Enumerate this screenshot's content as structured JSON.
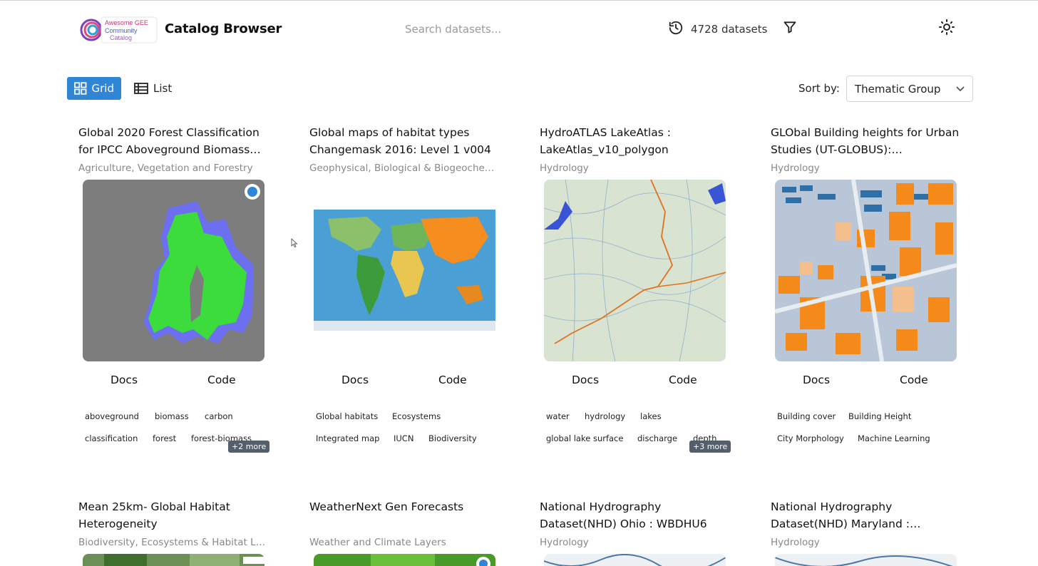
{
  "header": {
    "logo_lines": [
      "Awesome GEE",
      "Community",
      "Catalog"
    ],
    "title": "Catalog Browser",
    "search_placeholder": "Search datasets...",
    "dataset_count": "4728 datasets"
  },
  "toolbar": {
    "grid_label": "Grid",
    "list_label": "List",
    "sort_label": "Sort by:",
    "sort_value": "Thematic Group"
  },
  "colors": {
    "accent": "#2f86d6",
    "badge": "#555f6b"
  },
  "cards": [
    {
      "title": "Global 2020 Forest Classification for IPCC Aboveground Biomass…",
      "group": "Agriculture, Vegetation and Forestry",
      "docs": "Docs",
      "code": "Code",
      "tags": [
        "aboveground",
        "biomass",
        "carbon",
        "classification",
        "forest",
        "forest-biomass"
      ],
      "more": "+2 more"
    },
    {
      "title": "Global maps of habitat types Changemask 2016: Level 1 v004",
      "group": "Geophysical, Biological & Biogeoche…",
      "docs": "Docs",
      "code": "Code",
      "tags": [
        "Global habitats",
        "Ecosystems",
        "Integrated map",
        "IUCN",
        "Biodiversity"
      ]
    },
    {
      "title": "HydroATLAS LakeAtlas : LakeAtlas_v10_polygon",
      "group": "Hydrology",
      "docs": "Docs",
      "code": "Code",
      "tags": [
        "water",
        "hydrology",
        "lakes",
        "global lake surface",
        "discharge",
        "depth"
      ],
      "more": "+3 more"
    },
    {
      "title": "GLObal Building heights for Urban Studies (UT-GLOBUS):…",
      "group": "Hydrology",
      "docs": "Docs",
      "code": "Code",
      "tags": [
        "Building cover",
        "Building Height",
        "City Morphology",
        "Machine Learning"
      ]
    },
    {
      "title": "Mean 25km- Global Habitat Heterogeneity",
      "group": "Biodiversity, Ecosystems & Habitat La…"
    },
    {
      "title": "WeatherNext Gen Forecasts",
      "group": "Weather and Climate Layers"
    },
    {
      "title": "National Hydrography Dataset(NHD) Ohio : WBDHU6",
      "group": "Hydrology"
    },
    {
      "title": "National Hydrography Dataset(NHD) Maryland :…",
      "group": "Hydrology"
    }
  ]
}
